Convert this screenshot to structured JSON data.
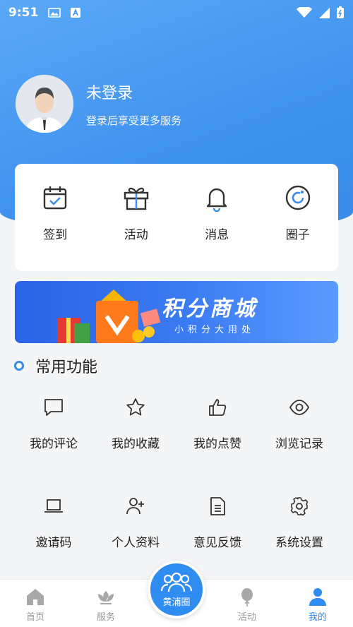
{
  "status_bar": {
    "time": "9:51"
  },
  "profile": {
    "title": "未登录",
    "subtitle": "登录后享受更多服务"
  },
  "quick_actions": [
    {
      "label": "签到",
      "icon": "calendar-check-icon"
    },
    {
      "label": "活动",
      "icon": "gift-icon"
    },
    {
      "label": "消息",
      "icon": "bell-icon"
    },
    {
      "label": "圈子",
      "icon": "circle-icon"
    }
  ],
  "banner": {
    "title": "积分商城",
    "subtitle": "小积分大用处"
  },
  "common": {
    "title": "常用功能",
    "items": [
      {
        "label": "我的评论",
        "icon": "comment-icon"
      },
      {
        "label": "我的收藏",
        "icon": "star-icon"
      },
      {
        "label": "我的点赞",
        "icon": "thumbs-up-icon"
      },
      {
        "label": "浏览记录",
        "icon": "eye-icon"
      },
      {
        "label": "邀请码",
        "icon": "laptop-icon"
      },
      {
        "label": "个人资料",
        "icon": "user-plus-icon"
      },
      {
        "label": "意见反馈",
        "icon": "document-icon"
      },
      {
        "label": "系统设置",
        "icon": "gear-icon"
      }
    ]
  },
  "tabbar": {
    "tabs": [
      {
        "label": "首页",
        "icon": "home-icon"
      },
      {
        "label": "服务",
        "icon": "lotus-icon"
      },
      {
        "label": "",
        "icon": ""
      },
      {
        "label": "活动",
        "icon": "balloon-icon"
      },
      {
        "label": "我的",
        "icon": "person-icon",
        "active": true
      }
    ],
    "center": {
      "label": "黄浦圈",
      "icon": "group-icon"
    }
  },
  "colors": {
    "primary": "#3a8bea",
    "tab_active": "#2f8cf0",
    "tab_inactive": "#999999"
  }
}
